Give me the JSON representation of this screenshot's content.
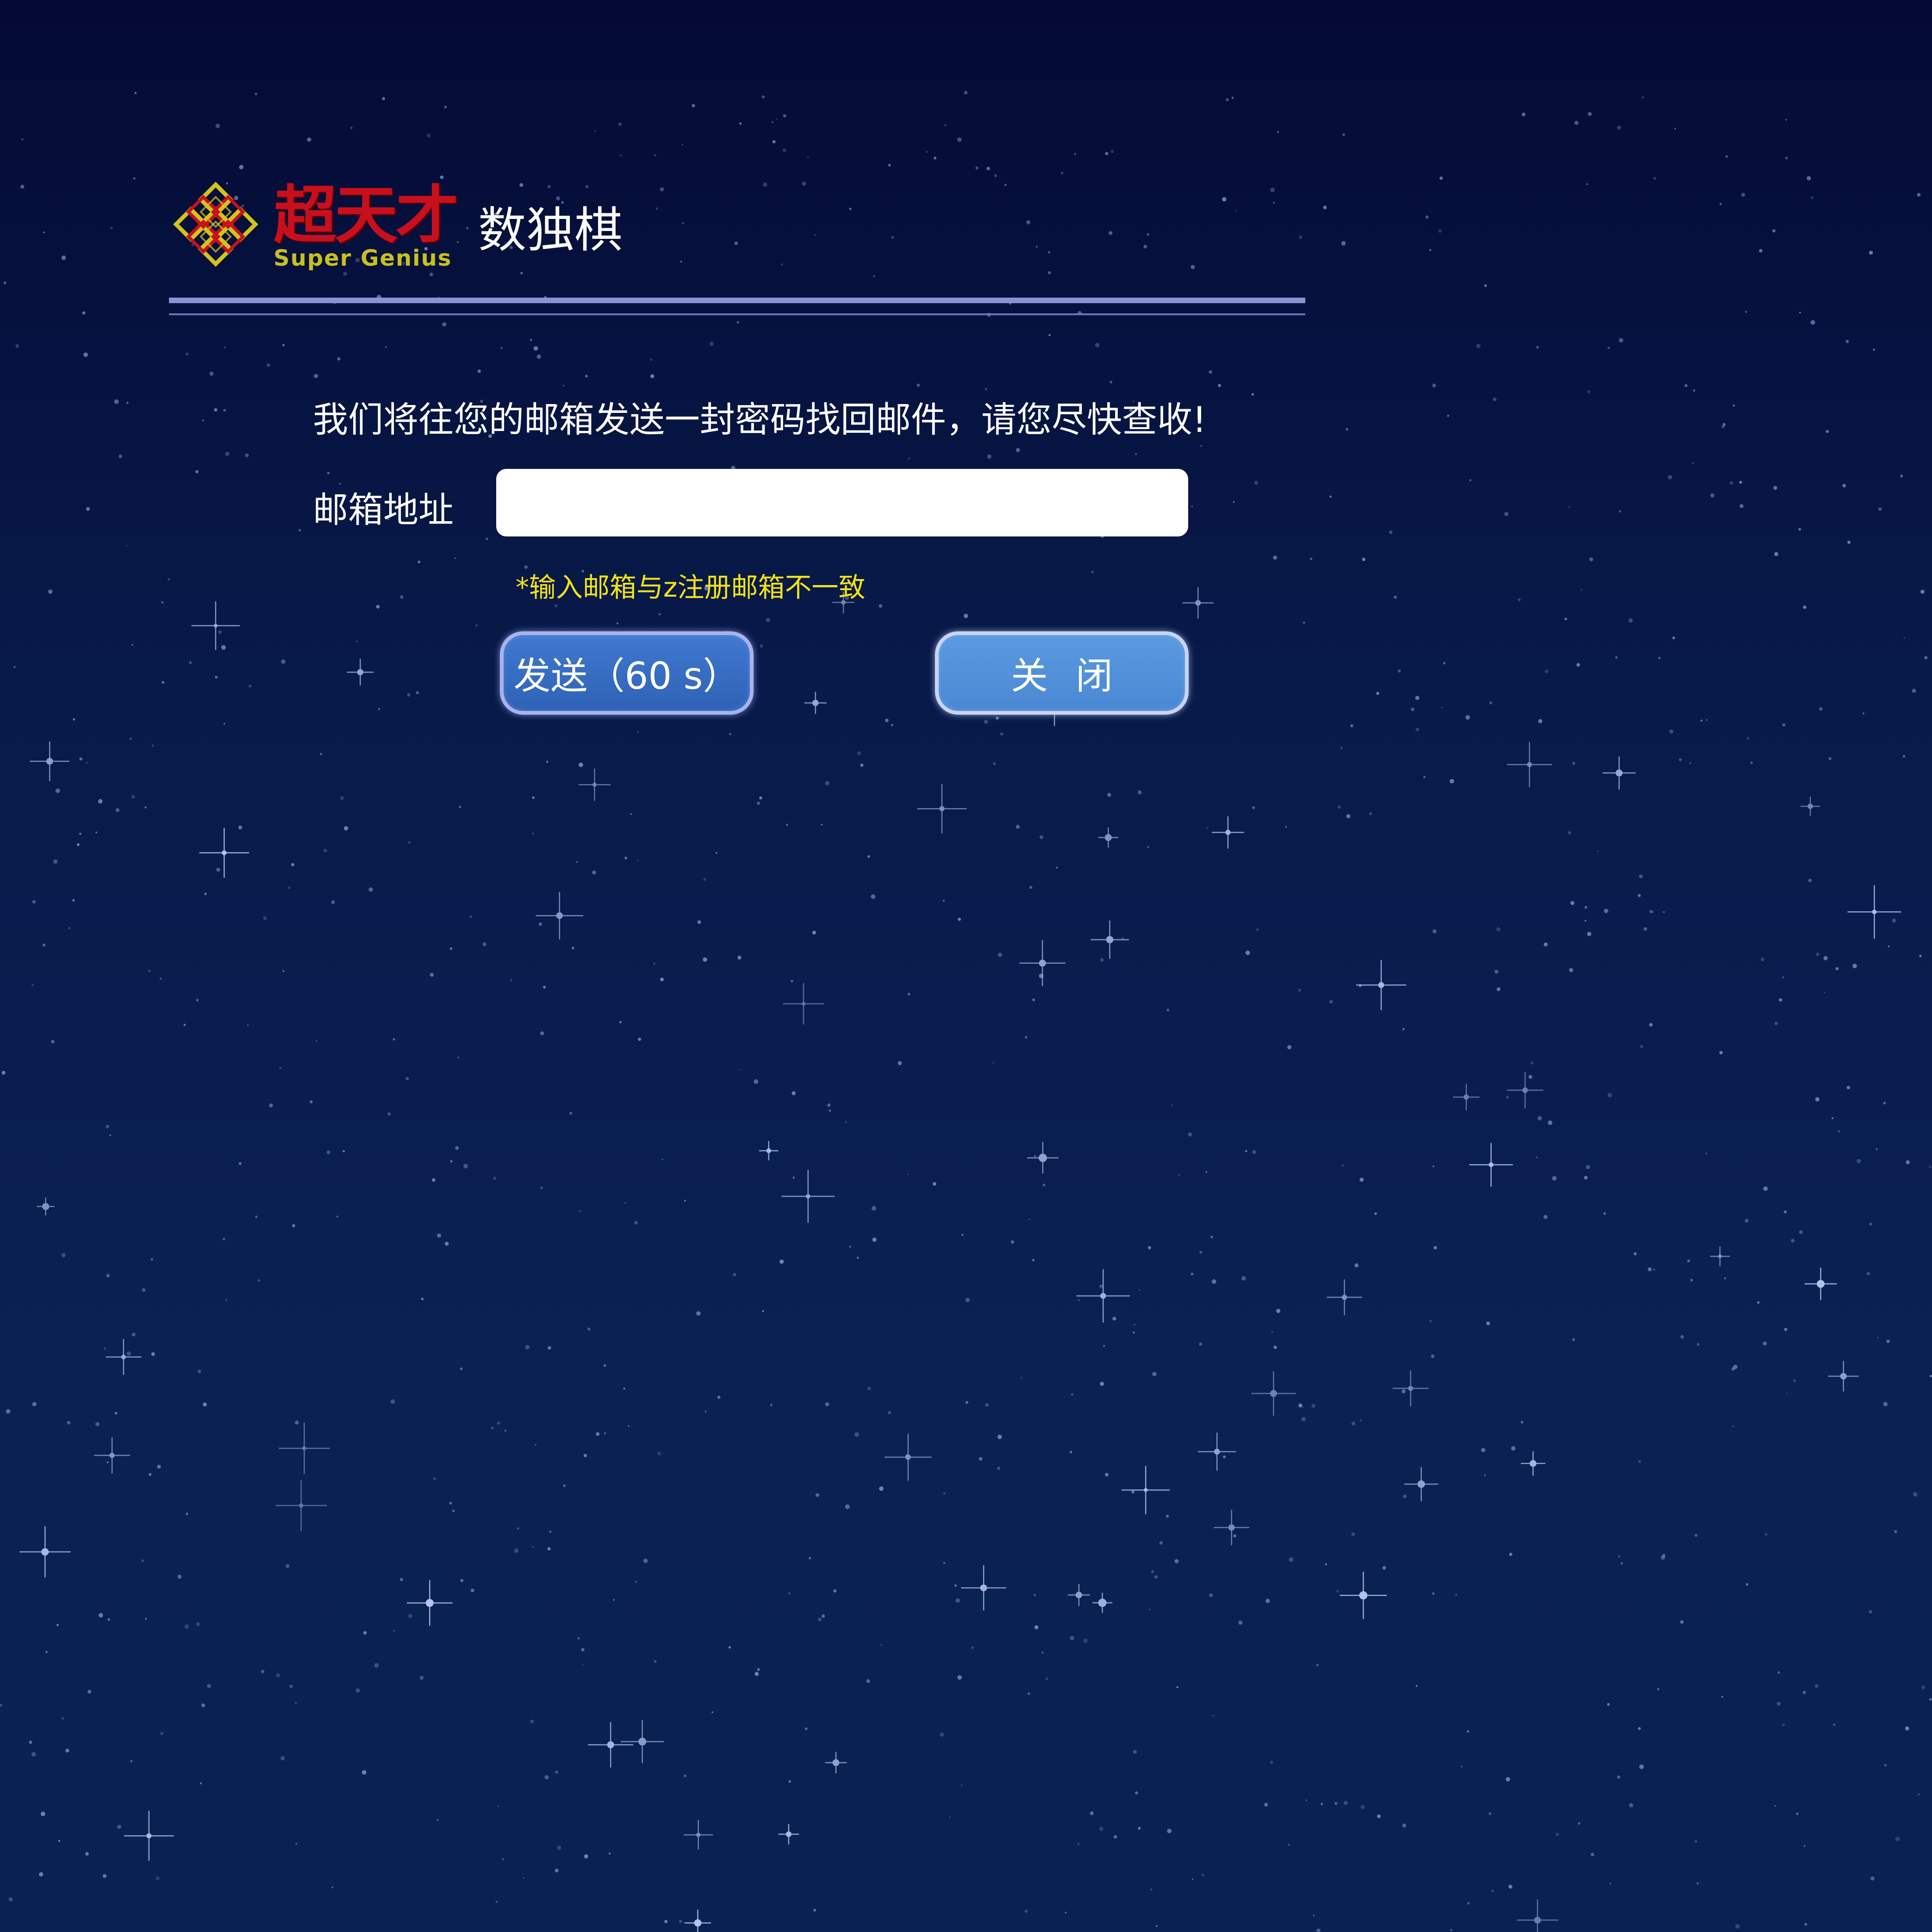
{
  "brand": {
    "cn": "超天才",
    "en": "Super Genius",
    "product": "数独棋"
  },
  "dialog": {
    "intro": "我们将往您的邮箱发送一封密码找回邮件，请您尽快查收!",
    "email_label": "邮箱地址",
    "email_value": "",
    "error": "*输入邮箱与z注册邮箱不一致",
    "send_label": "发送（60 s）",
    "close_label": "关闭"
  },
  "colors": {
    "background_top": "#040a34",
    "background_bottom": "#0a2252",
    "rule": "#8f91d6",
    "error": "#f2e21a",
    "brand_red": "#c8101c",
    "brand_yellow": "#c8c020",
    "send_button": "#3366bb",
    "close_button": "#4f8ed6"
  },
  "icons": {
    "logo": "endless-knot-logo-icon"
  }
}
